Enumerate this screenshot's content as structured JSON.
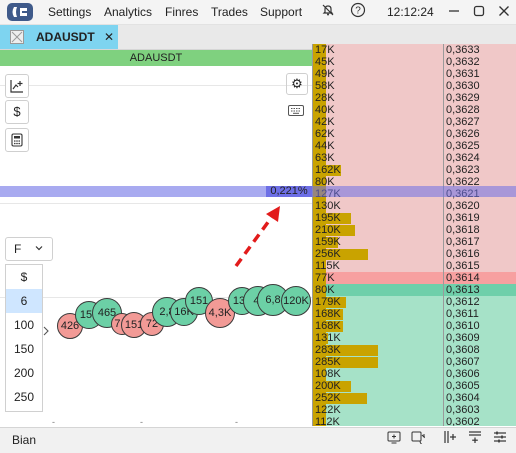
{
  "menu": [
    "Settings",
    "Analytics",
    "Finres",
    "Trades",
    "Support"
  ],
  "clock": "12:12:24",
  "titlebar_icons": [
    "mute-icon",
    "help-icon",
    "minimize-icon",
    "maximize-icon",
    "close-icon"
  ],
  "tab": {
    "label": "ADAUSDT",
    "close": "✕"
  },
  "chart": {
    "header": "ADAUSDT",
    "percent_label": "0,221%",
    "filter": "F",
    "sizes": [
      "$",
      "6",
      "100",
      "150",
      "200",
      "250"
    ],
    "selected_size": "6",
    "bubbles": [
      {
        "label": "426",
        "color": "sell"
      },
      {
        "label": "151",
        "color": "buy"
      },
      {
        "label": "465",
        "color": "buy"
      },
      {
        "label": "7,1",
        "color": "sell"
      },
      {
        "label": "151",
        "color": "sell"
      },
      {
        "label": "72",
        "color": "sell"
      },
      {
        "label": "2,8",
        "color": "buy"
      },
      {
        "label": "16K",
        "color": "buy"
      },
      {
        "label": "151",
        "color": "buy"
      },
      {
        "label": "4,3K",
        "color": "sell"
      },
      {
        "label": "131",
        "color": "buy"
      },
      {
        "label": "4,",
        "color": "buy"
      },
      {
        "label": "6,8",
        "color": "buy"
      },
      {
        "label": "120K",
        "color": "buy"
      }
    ]
  },
  "colors": {
    "tab_active": "#7ed4f0",
    "header": "#7fd17f",
    "ask_bg": "#f0c8c8",
    "bid_bg": "#a6e2c8",
    "volume_bar": "#c9a300",
    "best_ask": "#f7a0a0",
    "best_bid": "#6fcfaa",
    "highlight": "#a8aaf0"
  },
  "dom": [
    {
      "volume": "17K",
      "price": "0,3633",
      "side": "ask",
      "bar": 0
    },
    {
      "volume": "45K",
      "price": "0,3632",
      "side": "ask",
      "bar": 0
    },
    {
      "volume": "49K",
      "price": "0,3631",
      "side": "ask",
      "bar": 0
    },
    {
      "volume": "58K",
      "price": "0,3630",
      "side": "ask",
      "bar": 0
    },
    {
      "volume": "28K",
      "price": "0,3629",
      "side": "ask",
      "bar": 0
    },
    {
      "volume": "40K",
      "price": "0,3628",
      "side": "ask",
      "bar": 0
    },
    {
      "volume": "42K",
      "price": "0,3627",
      "side": "ask",
      "bar": 0
    },
    {
      "volume": "62K",
      "price": "0,3626",
      "side": "ask",
      "bar": 0
    },
    {
      "volume": "44K",
      "price": "0,3625",
      "side": "ask",
      "bar": 0
    },
    {
      "volume": "63K",
      "price": "0,3624",
      "side": "ask",
      "bar": 0
    },
    {
      "volume": "162K",
      "price": "0,3623",
      "side": "ask",
      "bar": 0.22
    },
    {
      "volume": "80K",
      "price": "0,3622",
      "side": "ask",
      "bar": 0
    },
    {
      "volume": "127K",
      "price": "0,3621",
      "side": "ask",
      "bar": 0.08
    },
    {
      "volume": "130K",
      "price": "0,3620",
      "side": "ask",
      "bar": 0.08
    },
    {
      "volume": "195K",
      "price": "0,3619",
      "side": "ask",
      "bar": 0.3
    },
    {
      "volume": "210K",
      "price": "0,3618",
      "side": "ask",
      "bar": 0.33
    },
    {
      "volume": "159K",
      "price": "0,3617",
      "side": "ask",
      "bar": 0.2
    },
    {
      "volume": "256K",
      "price": "0,3616",
      "side": "ask",
      "bar": 0.43
    },
    {
      "volume": "115K",
      "price": "0,3615",
      "side": "ask",
      "bar": 0.05
    },
    {
      "volume": "77K",
      "price": "0,3614",
      "side": "best_ask",
      "bar": 0
    },
    {
      "volume": "80K",
      "price": "0,3613",
      "side": "best_bid",
      "bar": 0
    },
    {
      "volume": "179K",
      "price": "0,3612",
      "side": "bid",
      "bar": 0.26
    },
    {
      "volume": "168K",
      "price": "0,3611",
      "side": "bid",
      "bar": 0.24
    },
    {
      "volume": "168K",
      "price": "0,3610",
      "side": "bid",
      "bar": 0.24
    },
    {
      "volume": "131K",
      "price": "0,3609",
      "side": "bid",
      "bar": 0.12
    },
    {
      "volume": "283K",
      "price": "0,3608",
      "side": "bid",
      "bar": 0.5
    },
    {
      "volume": "285K",
      "price": "0,3607",
      "side": "bid",
      "bar": 0.5
    },
    {
      "volume": "108K",
      "price": "0,3606",
      "side": "bid",
      "bar": 0.04
    },
    {
      "volume": "200K",
      "price": "0,3605",
      "side": "bid",
      "bar": 0.3
    },
    {
      "volume": "252K",
      "price": "0,3604",
      "side": "bid",
      "bar": 0.42
    },
    {
      "volume": "122K",
      "price": "0,3603",
      "side": "bid",
      "bar": 0.07
    },
    {
      "volume": "112K",
      "price": "0,3602",
      "side": "bid",
      "bar": 0.04
    }
  ],
  "status": {
    "exchange": "Bian"
  }
}
